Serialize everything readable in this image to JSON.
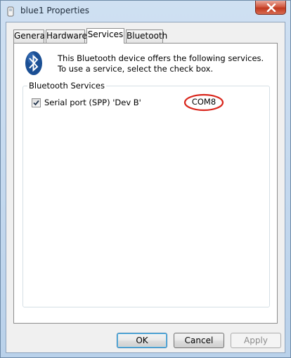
{
  "window": {
    "title": "blue1 Properties",
    "close_label": "Close"
  },
  "tabs": [
    {
      "label": "General",
      "active": false
    },
    {
      "label": "Hardware",
      "active": false
    },
    {
      "label": "Services",
      "active": true
    },
    {
      "label": "Bluetooth",
      "active": false
    }
  ],
  "services_panel": {
    "info_text": "This Bluetooth device offers the following services. To use a service, select the check box.",
    "group_label": "Bluetooth Services",
    "services": [
      {
        "label": "Serial port (SPP) 'Dev B'",
        "checked": true,
        "port": "COM8"
      }
    ]
  },
  "buttons": {
    "ok_label": "OK",
    "cancel_label": "Cancel",
    "apply_label": "Apply"
  },
  "colors": {
    "bluetooth_blue": "#1b4f94",
    "highlight_circle": "#d9261c"
  }
}
